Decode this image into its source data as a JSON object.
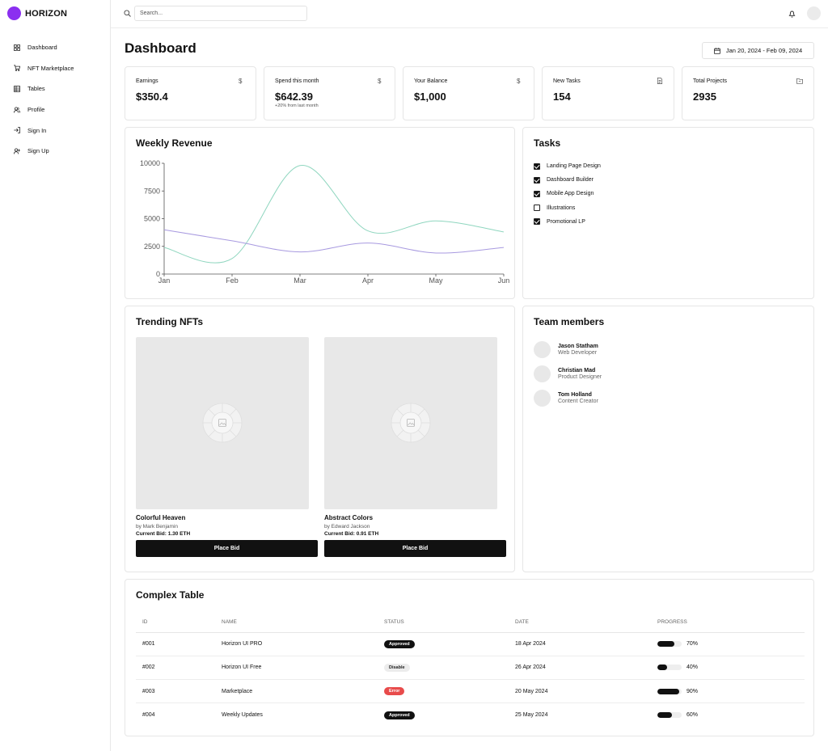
{
  "brand": {
    "name": "HORIZON",
    "color": "#8b2ff0"
  },
  "sidebar": {
    "items": [
      {
        "label": "Dashboard",
        "icon": "grid-icon"
      },
      {
        "label": "NFT Marketplace",
        "icon": "cart-icon"
      },
      {
        "label": "Tables",
        "icon": "table-icon"
      },
      {
        "label": "Profile",
        "icon": "users-icon"
      },
      {
        "label": "Sign In",
        "icon": "sign-in-icon"
      },
      {
        "label": "Sign Up",
        "icon": "user-plus-icon"
      }
    ]
  },
  "header": {
    "search_placeholder": "Search..."
  },
  "page": {
    "title": "Dashboard",
    "date_range": "Jan 20, 2024 - Feb 09, 2024"
  },
  "stats": [
    {
      "label": "Earnings",
      "value": "$350.4",
      "sub": "",
      "icon": "$"
    },
    {
      "label": "Spend this month",
      "value": "$642.39",
      "sub": "+20% from last month",
      "icon": "$"
    },
    {
      "label": "Your Balance",
      "value": "$1,000",
      "sub": "",
      "icon": "$"
    },
    {
      "label": "New Tasks",
      "value": "154",
      "sub": "",
      "icon": "document-icon"
    },
    {
      "label": "Total Projects",
      "value": "2935",
      "sub": "",
      "icon": "folder-icon"
    }
  ],
  "revenue": {
    "title": "Weekly Revenue"
  },
  "chart_data": {
    "type": "line",
    "title": "Weekly Revenue",
    "xlabel": "",
    "ylabel": "",
    "categories": [
      "Jan",
      "Feb",
      "Mar",
      "Apr",
      "May",
      "Jun"
    ],
    "yticks": [
      "0",
      "2500",
      "5000",
      "7500",
      "10000"
    ],
    "ylim": [
      0,
      10000
    ],
    "series": [
      {
        "color": "#8fd6bf",
        "values": [
          2400,
          1400,
          9800,
          3900,
          4800,
          3800
        ]
      },
      {
        "color": "#a89ae0",
        "values": [
          4000,
          3000,
          2000,
          2800,
          1900,
          2400
        ]
      }
    ]
  },
  "tasks": {
    "title": "Tasks",
    "items": [
      {
        "label": "Landing Page Design",
        "checked": true
      },
      {
        "label": "Dashboard Builder",
        "checked": true
      },
      {
        "label": "Mobile App Design",
        "checked": true
      },
      {
        "label": "Illustrations",
        "checked": false
      },
      {
        "label": "Promotional LP",
        "checked": true
      }
    ]
  },
  "nfts": {
    "title": "Trending NFTs",
    "items": [
      {
        "name": "Colorful Heaven",
        "author": "by Mark Benjamin",
        "bid": "Current Bid: 1.30 ETH",
        "button": "Place Bid"
      },
      {
        "name": "Abstract Colors",
        "author": "by Edward Jackson",
        "bid": "Current Bid: 0.91 ETH",
        "button": "Place Bid"
      }
    ]
  },
  "team": {
    "title": "Team members",
    "members": [
      {
        "name": "Jason Statham",
        "role": "Web Developer"
      },
      {
        "name": "Christian Mad",
        "role": "Product Designer"
      },
      {
        "name": "Tom Holland",
        "role": "Content Creator"
      }
    ]
  },
  "table": {
    "title": "Complex Table",
    "headers": [
      "ID",
      "NAME",
      "STATUS",
      "DATE",
      "PROGRESS"
    ],
    "rows": [
      {
        "id": "#001",
        "name": "Horizon UI PRO",
        "status": "Approved",
        "status_type": "approved",
        "date": "18 Apr 2024",
        "progress": "70%",
        "progress_value": 0.7
      },
      {
        "id": "#002",
        "name": "Horizon UI Free",
        "status": "Disable",
        "status_type": "disable",
        "date": "26 Apr 2024",
        "progress": "40%",
        "progress_value": 0.4
      },
      {
        "id": "#003",
        "name": "Marketplace",
        "status": "Error",
        "status_type": "error",
        "date": "20 May 2024",
        "progress": "90%",
        "progress_value": 0.9
      },
      {
        "id": "#004",
        "name": "Weekly Updates",
        "status": "Approved",
        "status_type": "approved",
        "date": "25 May 2024",
        "progress": "60%",
        "progress_value": 0.6
      }
    ]
  }
}
